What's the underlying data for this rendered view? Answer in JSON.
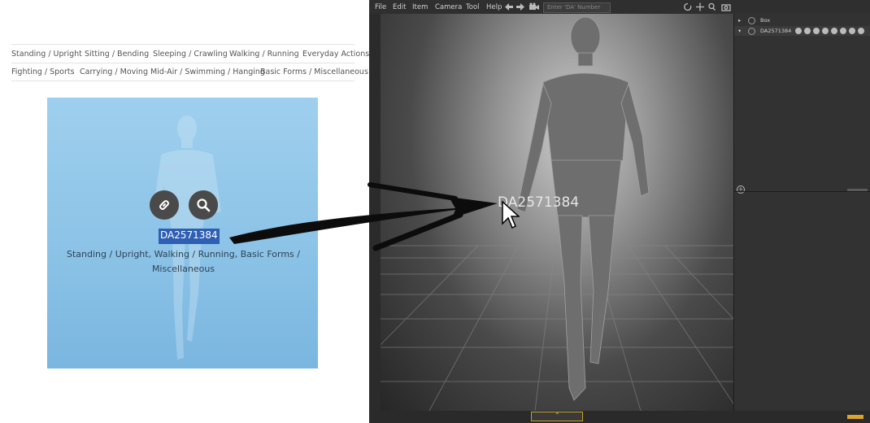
{
  "categories": {
    "row1": [
      "Standing / Upright",
      "Sitting / Bending",
      "Sleeping / Crawling",
      "Walking / Running",
      "Everyday Actions"
    ],
    "row2": [
      "Fighting / Sports",
      "Carrying / Moving",
      "Mid-Air / Swimming / Hanging",
      "Basic Forms / Miscellaneous"
    ]
  },
  "card": {
    "id": "DA2571384",
    "tags_line1": "Standing / Upright, Walking / Running, Basic Forms /",
    "tags_line2": "Miscellaneous",
    "link_icon": "link-icon",
    "zoom_icon": "search-icon"
  },
  "app": {
    "menu": [
      "File",
      "Edit",
      "Item",
      "Camera",
      "Tool",
      "Help"
    ],
    "search_placeholder": "Enter 'DA' Number",
    "viewport_label": "DA2571384",
    "scene_items": [
      {
        "label": "Box"
      },
      {
        "label": "DA2571384"
      }
    ],
    "toolbar_icons": [
      "undo-icon",
      "redo-icon",
      "camera-icon",
      "rotate-icon",
      "move-icon",
      "zoom-icon",
      "snapshot-icon"
    ]
  },
  "colors": {
    "card_bg": "#8cc3e7",
    "highlight": "#2f5fb3",
    "accent": "#f3c63c",
    "app_bg": "#2b2b2b"
  }
}
